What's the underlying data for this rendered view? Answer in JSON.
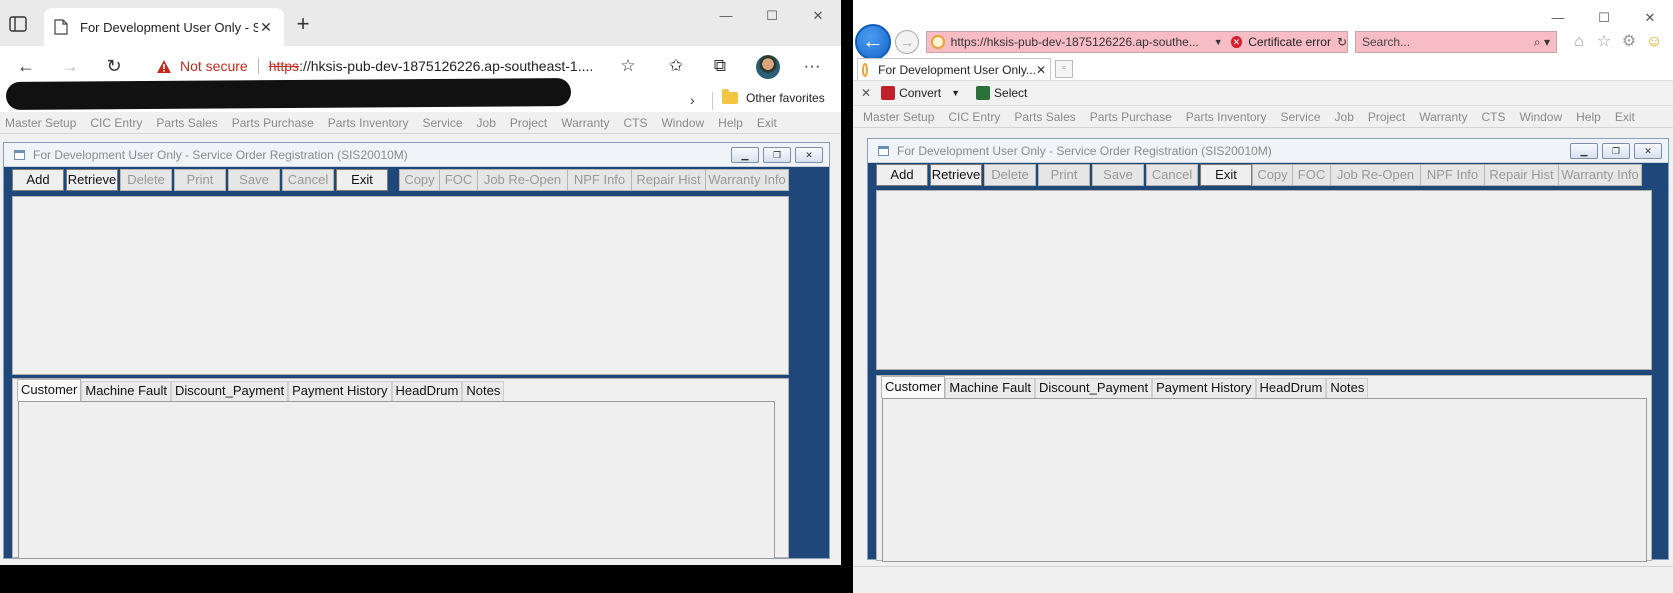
{
  "edge": {
    "tab_title": "For Development User Only - Ser",
    "not_secure": "Not secure",
    "url_scheme": "https",
    "url_rest": "://hksis-pub-dev-1875126226.ap-southeast-1....",
    "other_favorites": "Other favorites"
  },
  "ie": {
    "url": "https://hksis-pub-dev-1875126226.ap-southe...",
    "certificate_error": "Certificate error",
    "search_placeholder": "Search...",
    "tab_title": "For Development User Only...",
    "cmd_convert": "Convert",
    "cmd_select": "Select"
  },
  "app": {
    "menu": [
      "Master Setup",
      "CIC Entry",
      "Parts Sales",
      "Parts Purchase",
      "Parts Inventory",
      "Service",
      "Job",
      "Project",
      "Warranty",
      "CTS",
      "Window",
      "Help",
      "Exit"
    ],
    "window_title": "For Development User Only - Service Order Registration (SIS20010M)",
    "toolbar": {
      "add": "Add",
      "retrieve": "Retrieve",
      "delete": "Delete",
      "print": "Print",
      "save": "Save",
      "cancel": "Cancel",
      "exit": "Exit"
    },
    "toolbar2": {
      "copy": "Copy",
      "foc": "FOC",
      "job_reopen": "Job Re-Open",
      "npf_info": "NPF Info",
      "repair_hist": "Repair Hist",
      "warranty_info": "Warranty Info"
    },
    "tabs": [
      "Customer",
      "Machine Fault",
      "Discount_Payment",
      "Payment History",
      "HeadDrum",
      "Notes"
    ]
  },
  "colors": {
    "mdi_frame": "#1f4878",
    "ie_addr_bg": "#f8bcc4",
    "not_secure": "#c42b1c"
  }
}
